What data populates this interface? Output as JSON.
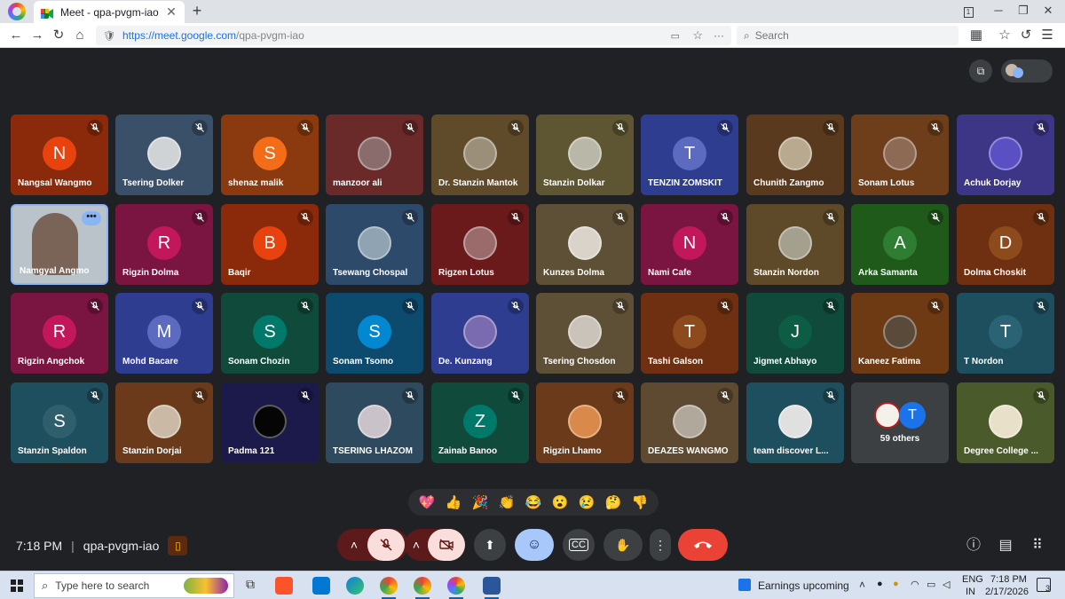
{
  "browser": {
    "tab_title": "Meet - qpa-pvgm-iao",
    "url_host": "https://meet.google.com",
    "url_path": "/qpa-pvgm-iao",
    "search_placeholder": "Search",
    "tab_count": "1"
  },
  "meeting": {
    "time": "7:18 PM",
    "code": "qpa-pvgm-iao"
  },
  "participants": [
    {
      "name": "Nangsal Wangmo",
      "initial": "N",
      "bg": "#8a2a0a",
      "avatar": "#e8430f",
      "photo": false
    },
    {
      "name": "Tsering Dolker",
      "initial": "",
      "bg": "#3a4f68",
      "avatar": "#cfd3d6",
      "photo": true
    },
    {
      "name": "shenaz malik",
      "initial": "S",
      "bg": "#8a3a0e",
      "avatar": "#f36c17",
      "photo": false
    },
    {
      "name": "manzoor ali",
      "initial": "",
      "bg": "#6a2a2a",
      "avatar": "#8a6c6c",
      "photo": true
    },
    {
      "name": "Dr. Stanzin Mantok",
      "initial": "",
      "bg": "#5f4a2a",
      "avatar": "#9b8f7a",
      "photo": true
    },
    {
      "name": "Stanzin Dolkar",
      "initial": "",
      "bg": "#5e5632",
      "avatar": "#b9b7a7",
      "photo": true
    },
    {
      "name": "TENZIN ZOMSKIT",
      "initial": "T",
      "bg": "#2e3d8f",
      "avatar": "#5c6bc0",
      "photo": false
    },
    {
      "name": "Chunith Zangmo",
      "initial": "",
      "bg": "#5a3a1e",
      "avatar": "#b9a98f",
      "photo": true
    },
    {
      "name": "Sonam Lotus",
      "initial": "",
      "bg": "#6e3e1a",
      "avatar": "#8c6a54",
      "photo": true
    },
    {
      "name": "Achuk Dorjay",
      "initial": "",
      "bg": "#3d3585",
      "avatar": "#5b4fc4",
      "photo": true
    },
    {
      "name": "Namgyal Angmo",
      "initial": "",
      "bg": "#b9c3c9",
      "avatar": "#7a6458",
      "photo": true,
      "selected": true
    },
    {
      "name": "Rigzin Dolma",
      "initial": "R",
      "bg": "#7a1440",
      "avatar": "#c2185b",
      "photo": false
    },
    {
      "name": "Baqir",
      "initial": "B",
      "bg": "#8a2a0a",
      "avatar": "#e8430f",
      "photo": false
    },
    {
      "name": "Tsewang Chospal",
      "initial": "",
      "bg": "#2e4a6a",
      "avatar": "#8fa3b3",
      "photo": true
    },
    {
      "name": "Rigzen Lotus",
      "initial": "",
      "bg": "#6a1a1a",
      "avatar": "#9b6a6a",
      "photo": true
    },
    {
      "name": "Kunzes Dolma",
      "initial": "",
      "bg": "#5e5036",
      "avatar": "#d9d3c9",
      "photo": true
    },
    {
      "name": "Nami Cafe",
      "initial": "N",
      "bg": "#7a1440",
      "avatar": "#c2185b",
      "photo": false
    },
    {
      "name": "Stanzin Nordon",
      "initial": "",
      "bg": "#5e4a28",
      "avatar": "#a59f8e",
      "photo": true
    },
    {
      "name": "Arka Samanta",
      "initial": "A",
      "bg": "#1f5a1a",
      "avatar": "#2e7d32",
      "photo": false
    },
    {
      "name": "Dolma Choskit",
      "initial": "D",
      "bg": "#6e3010",
      "avatar": "#8d4a1c",
      "photo": false
    },
    {
      "name": "Rigzin Angchok",
      "initial": "R",
      "bg": "#7a1440",
      "avatar": "#c2185b",
      "photo": false
    },
    {
      "name": "Mohd Bacare",
      "initial": "M",
      "bg": "#2e3d8f",
      "avatar": "#5c6bc0",
      "photo": false
    },
    {
      "name": "Sonam Chozin",
      "initial": "S",
      "bg": "#0f4a3a",
      "avatar": "#00796b",
      "photo": false
    },
    {
      "name": "Sonam Tsomo",
      "initial": "S",
      "bg": "#0c4a6e",
      "avatar": "#0288d1",
      "photo": false
    },
    {
      "name": "De. Kunzang",
      "initial": "",
      "bg": "#2e3d8f",
      "avatar": "#7a6ab0",
      "photo": true
    },
    {
      "name": "Tsering Chosdon",
      "initial": "",
      "bg": "#5e5036",
      "avatar": "#c9c3b9",
      "photo": true
    },
    {
      "name": "Tashi Galson",
      "initial": "T",
      "bg": "#6e3010",
      "avatar": "#8d4a1c",
      "photo": false
    },
    {
      "name": "Jigmet Abhayo",
      "initial": "J",
      "bg": "#0f4a3a",
      "avatar": "#0d5c44",
      "photo": false
    },
    {
      "name": "Kaneez Fatima",
      "initial": "",
      "bg": "#6e3a14",
      "avatar": "#5a4a3a",
      "photo": true
    },
    {
      "name": "T Nordon",
      "initial": "T",
      "bg": "#1e4f5e",
      "avatar": "#2a6474",
      "photo": false
    },
    {
      "name": "Stanzin Spaldon",
      "initial": "S",
      "bg": "#1e4f5e",
      "avatar": "#2f5f6d",
      "photo": false
    },
    {
      "name": "Stanzin Dorjai",
      "initial": "",
      "bg": "#6a3a1a",
      "avatar": "#c9b9a5",
      "photo": true
    },
    {
      "name": "Padma 121",
      "initial": "",
      "bg": "#1c1a4a",
      "avatar": "#050505",
      "photo": true
    },
    {
      "name": "TSERING LHAZOM",
      "initial": "",
      "bg": "#2e4a5e",
      "avatar": "#c9c3c9",
      "photo": true
    },
    {
      "name": "Zainab Banoo",
      "initial": "Z",
      "bg": "#0f4a3a",
      "avatar": "#00796b",
      "photo": false
    },
    {
      "name": "Rigzin Lhamo",
      "initial": "",
      "bg": "#6a3a1a",
      "avatar": "#d98a4a",
      "photo": true
    },
    {
      "name": "DEAZES WANGMO",
      "initial": "",
      "bg": "#5e4a30",
      "avatar": "#b0a89a",
      "photo": true
    },
    {
      "name": "team discover L...",
      "initial": "",
      "bg": "#1e4f5e",
      "avatar": "#e0e0e0",
      "photo": true
    },
    {
      "name": "59 others",
      "initial": "T",
      "bg": "#3c4043",
      "avatar": "#1a73e8",
      "photo": false,
      "others": true
    },
    {
      "name": "Degree College ...",
      "initial": "",
      "bg": "#4a5a2a",
      "avatar": "#e8e0c9",
      "photo": true
    }
  ],
  "reactions": [
    "💖",
    "👍",
    "🎉",
    "👏",
    "😂",
    "😮",
    "😢",
    "🤔",
    "👎"
  ],
  "taskbar": {
    "search_placeholder": "Type here to search",
    "weather_text": "Earnings upcoming",
    "lang_line1": "ENG",
    "lang_line2": "IN",
    "clock_time": "7:18 PM",
    "clock_date": "2/17/2026",
    "notif_count": "3"
  },
  "colors": {
    "meet_bg": "#202124",
    "end_call": "#ea4335",
    "active_control": "#a8c7fa",
    "muted_control": "#f9dedc"
  }
}
